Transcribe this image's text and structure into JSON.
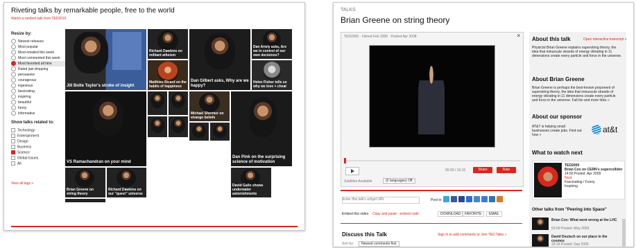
{
  "left": {
    "title": "Riveting talks by remarkable people, free to the world",
    "subtitle": "Watch a random talk from TED2015",
    "resize_label": "Resize by:",
    "resize_options": [
      "Newest releases",
      "Most popular",
      "Most emailed this week",
      "Most commented this week",
      "Most favorited all time",
      "Rated jaw-dropping",
      "persuasive",
      "courageous",
      "ingenious",
      "fascinating",
      "inspiring",
      "beautiful",
      "funny",
      "informative"
    ],
    "selected_resize": 4,
    "show_label": "Show talks related to:",
    "topics": [
      "Technology",
      "Entertainment",
      "Design",
      "Business",
      "Science",
      "Global Issues",
      "All"
    ],
    "selected_topic": 4,
    "view_all": "View all tags »",
    "tiles": {
      "jill": "Jill Bolte Taylor's stroke of insight",
      "dan_gilbert": "Dan Gilbert asks, Why are we happy?",
      "vs": "VS Ramachandran on your mind",
      "dan_pink": "Dan Pink on the surprising science of motivation",
      "dawkins": "Richard Dawkins on militant atheism",
      "ricard": "Matthieu Ricard on the habits of happiness",
      "ariely": "Dan Ariely asks, Are we in control of our own decisions?",
      "fisher": "Helen Fisher tells us why we love + cheat",
      "shermer": "Michael Shermer on strange beliefs",
      "loftus": "Elizabeth Loftus on the fiction of memory",
      "gilbert_brain": "Barry Schwartz on our loss of wisdom",
      "greene_small": "Brian Greene on string theory",
      "dawkins2": "Richard Dawkins on our \"queer\" universe",
      "neil": "David Deutsch on our place in the cosmos",
      "jane": "Jose Delgado shares his bullfighting science",
      "gold": "David Gallo shows underwater astonishments"
    }
  },
  "right": {
    "section": "TALKS",
    "title": "Brian Greene on string theory",
    "video_meta": "TED2005 · Filmed Feb 2005 · Posted Apr 2008",
    "time": "00:00 / 16:15",
    "share_btn": "Share",
    "fav_btn": "Rate",
    "subtitles_label": "Subtitles Available",
    "subtitles_value": "(0 languages) Off",
    "url_placeholder": "Enter this talk's url/get URL",
    "post_to": "Post to",
    "embed_label": "Embed this video",
    "embed_links": "Copy and paste · embed code",
    "download": "DOWNLOAD",
    "favorite": "FAVORITE",
    "email": "EMAIL",
    "discuss_title": "Discuss this Talk",
    "discuss_link": "Sign in to add comments or Join TED Talks »",
    "sort_label": "Sort by:",
    "sort_value": "Newest comments first",
    "about_talk_h": "About this talk",
    "about_talk_link": "Open interactive transcript »",
    "about_talk_text": "Physicist Brian Greene explains superstring theory, the idea that minuscule strands of energy vibrating in 11 dimensions create every particle and force in the universe.",
    "about_speaker_h": "About Brian Greene",
    "about_speaker_text": "Brian Greene is perhaps the best-known proponent of superstring theory, the idea that minuscule strands of energy vibrating in 11 dimensions create every particle and force in the universe. Full bio and more links »",
    "sponsor_h": "About our sponsor",
    "sponsor_text": "AT&T is helping small businesses create jobs. Find out how »",
    "att_logo": "at&t",
    "next_h": "What to watch next",
    "next_items": [
      "TED2009",
      "Brian Cox on CERN's supercollider",
      "14:50 Posted: Apr 2009",
      "Next:",
      "Fascinating / Funny",
      "Inspiring"
    ],
    "other_h": "Other talks from \"Peering into Space\"",
    "other1": "Brian Cox: What went wrong at the LHC",
    "other1_meta": "03:09 Posted: May 2009",
    "other2": "David Deutsch on our place in the cosmos",
    "other2_meta": "18:18 Posted: Sep 2005"
  }
}
